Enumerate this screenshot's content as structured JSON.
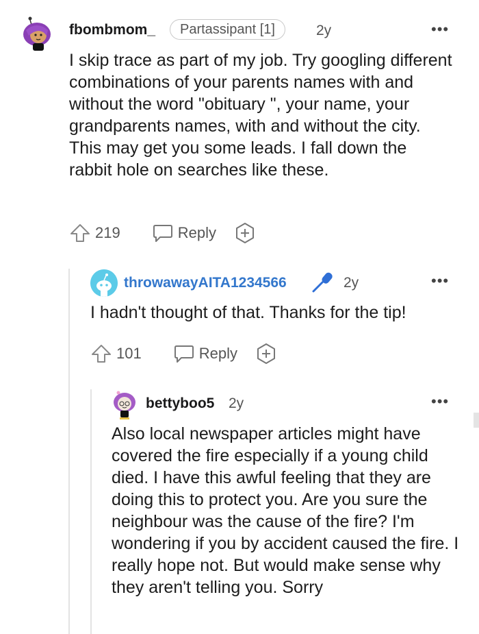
{
  "comments": [
    {
      "username": "fbombmom_",
      "flair": "Partassipant [1]",
      "age": "2y",
      "more": "•••",
      "body": "I skip trace as part of my job. Try googling different combinations of your parents names with and without the word \"obituary \", your name, your grandparents names, with and without the city. This may get you some leads. I fall down the rabbit hole on searches like these.",
      "votes": "219",
      "reply": "Reply"
    },
    {
      "username": "throwawayAITA1234566",
      "age": "2y",
      "more": "•••",
      "body": "I hadn't thought of that. Thanks for the tip!",
      "votes": "101",
      "reply": "Reply",
      "username_color": "#3377cc"
    },
    {
      "username": "bettyboo5",
      "age": "2y",
      "more": "•••",
      "body": "Also local newspaper articles might have covered the fire especially if a young child died. I have this awful feeling that they are doing this to protect you. Are you sure the neighbour was the cause of the fire? I'm wondering if you by accident caused the fire. I really hope not. But would make sense why they aren't telling you. Sorry"
    }
  ]
}
